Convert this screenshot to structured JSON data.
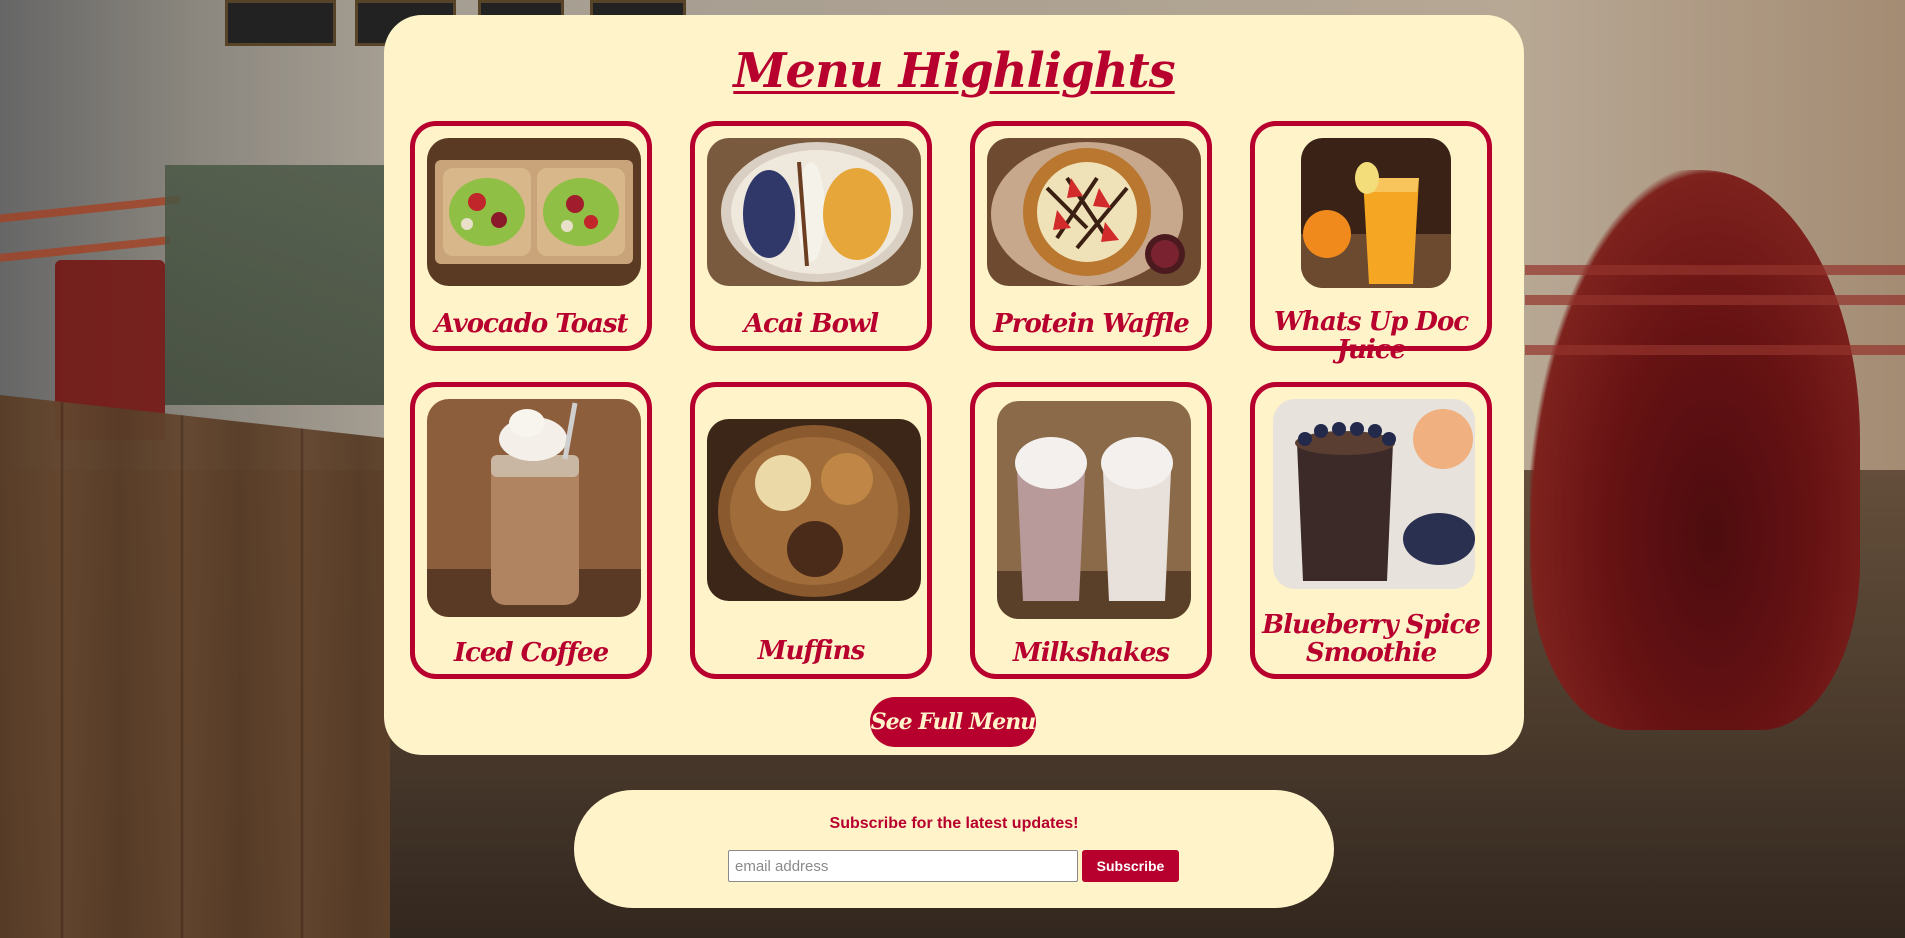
{
  "menu": {
    "title": "Menu Highlights",
    "items": [
      {
        "label": "Avocado Toast"
      },
      {
        "label": "Acai Bowl"
      },
      {
        "label": "Protein Waffle"
      },
      {
        "label": "Whats Up Doc Juice"
      },
      {
        "label": "Iced Coffee"
      },
      {
        "label": "Muffins"
      },
      {
        "label": "Milkshakes"
      },
      {
        "label": "Blueberry Spice Smoothie"
      }
    ],
    "full_menu_label": "See Full Menu"
  },
  "subscribe": {
    "heading": "Subscribe for the latest updates!",
    "email_placeholder": "email address",
    "button_label": "Subscribe"
  },
  "colors": {
    "accent": "#b8002f",
    "card_background": "#fff3c9"
  }
}
